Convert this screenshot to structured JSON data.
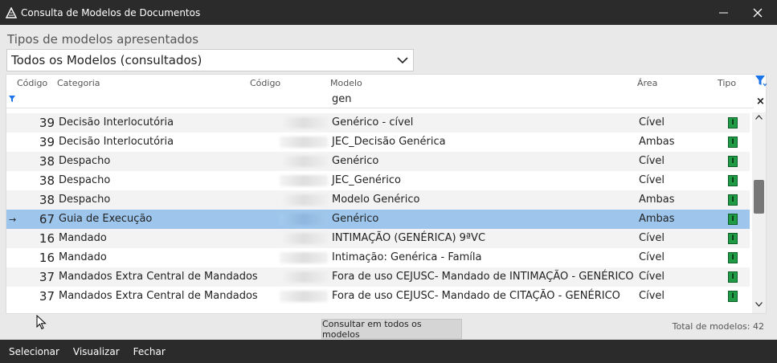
{
  "window": {
    "title": "Consulta de Modelos de Documentos",
    "minimize": "—",
    "close": "✕"
  },
  "filter": {
    "label": "Tipos de modelos apresentados",
    "selected": "Todos os Modelos (consultados)"
  },
  "grid": {
    "columns": [
      "Código",
      "Categoria",
      "Código",
      "Modelo",
      "Área",
      "Tipo"
    ],
    "filter_value": "gen",
    "rows": [
      {
        "code": "39",
        "category": "Decisão Interlocutória",
        "model": "Genérico - cível",
        "area": "Cível",
        "type_icon": "I"
      },
      {
        "code": "39",
        "category": "Decisão Interlocutória",
        "model": "JEC_Decisão Genérica",
        "area": "Ambas",
        "type_icon": "I"
      },
      {
        "code": "38",
        "category": "Despacho",
        "model": "Genérico",
        "area": "Cível",
        "type_icon": "I"
      },
      {
        "code": "38",
        "category": "Despacho",
        "model": "JEC_Genérico",
        "area": "Cível",
        "type_icon": "I"
      },
      {
        "code": "38",
        "category": "Despacho",
        "model": "Modelo Genérico",
        "area": "Ambas",
        "type_icon": "I"
      },
      {
        "code": "67",
        "category": "Guia de Execução",
        "model": "Genérico",
        "area": "Ambas",
        "type_icon": "I",
        "selected": true
      },
      {
        "code": "16",
        "category": "Mandado",
        "model": "INTIMAÇÃO (GENÉRICA) 9ªVC",
        "area": "Cível",
        "type_icon": "I"
      },
      {
        "code": "16",
        "category": "Mandado",
        "model": "Intimação: Genérica - Famíla",
        "area": "Cível",
        "type_icon": "I"
      },
      {
        "code": "37",
        "category": "Mandados Extra Central de Mandados",
        "model": "Fora de uso CEJUSC-  Mandado de INTIMAÇÃO - GENÉRICO",
        "area": "Cível",
        "type_icon": "I"
      },
      {
        "code": "37",
        "category": "Mandados Extra Central de Mandados",
        "model": "Fora de uso CEJUSC- Mandado de CITAÇÃO - GENÉRICO",
        "area": "Cível",
        "type_icon": "I"
      }
    ]
  },
  "tools": {
    "clear": "×"
  },
  "consult_button": "Consultar em todos os modelos",
  "total": "Total de modelos: 42",
  "bottom_menu": {
    "select": "Selecionar",
    "view": "Visualizar",
    "close": "Fechar"
  },
  "colors": {
    "titlebar": "#2b2b2b",
    "selection": "#9ec6ec",
    "type_icon": "#1f9b45",
    "filter_icon": "#1a73e8"
  }
}
